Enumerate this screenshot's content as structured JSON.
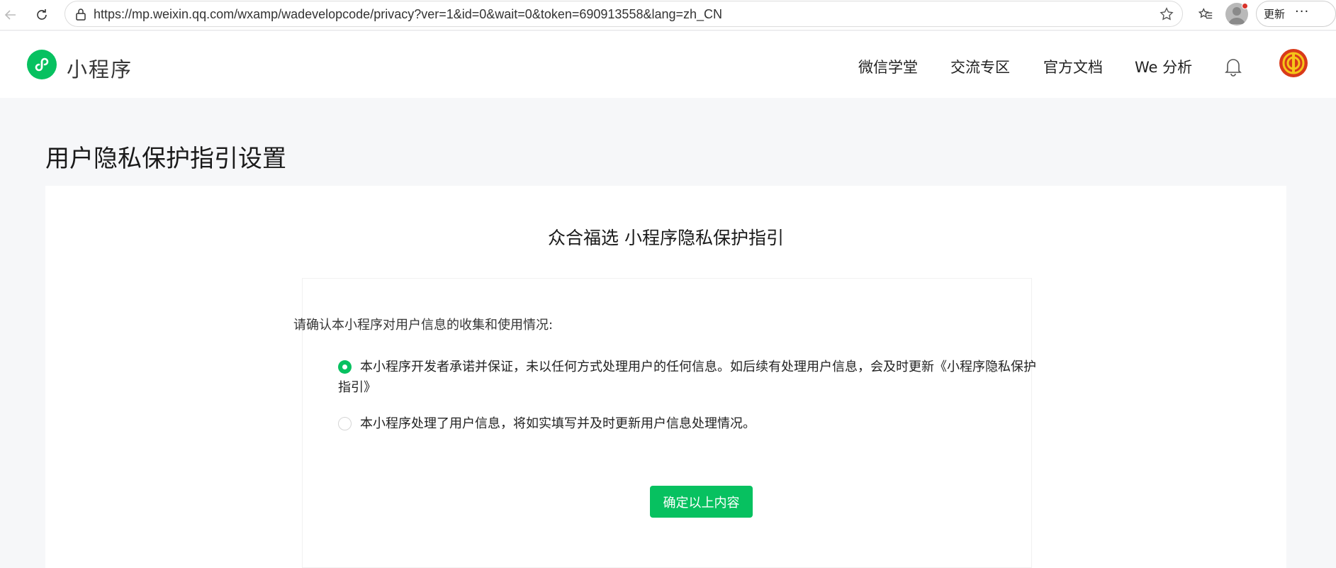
{
  "browser": {
    "url": "https://mp.weixin.qq.com/wxamp/wadevelopcode/privacy?ver=1&id=0&wait=0&token=690913558&lang=zh_CN",
    "update_label": "更新",
    "more_label": "···"
  },
  "header": {
    "logo_text": "小程序",
    "nav": [
      "微信学堂",
      "交流专区",
      "官方文档",
      "We 分析"
    ]
  },
  "page": {
    "title": "用户隐私保护指引设置"
  },
  "card": {
    "title": "众合福选 小程序隐私保护指引",
    "question": "请确认本小程序对用户信息的收集和使用情况:",
    "options": [
      {
        "label": "本小程序开发者承诺并保证，未以任何方式处理用户的任何信息。如后续有处理用户信息，会及时更新《小程序隐私保护指引》",
        "selected": true
      },
      {
        "label": "本小程序处理了用户信息，将如实填写并及时更新用户信息处理情况。",
        "selected": false
      }
    ],
    "confirm_label": "确定以上内容"
  },
  "colors": {
    "brand_green": "#07c160",
    "avatar_red": "#d93a1a"
  },
  "icons": [
    "back-arrow-icon",
    "reload-icon",
    "lock-icon",
    "star-icon",
    "favorites-icon",
    "profile-icon",
    "mini-program-logo-icon",
    "bell-icon",
    "avatar-emblem-icon"
  ]
}
